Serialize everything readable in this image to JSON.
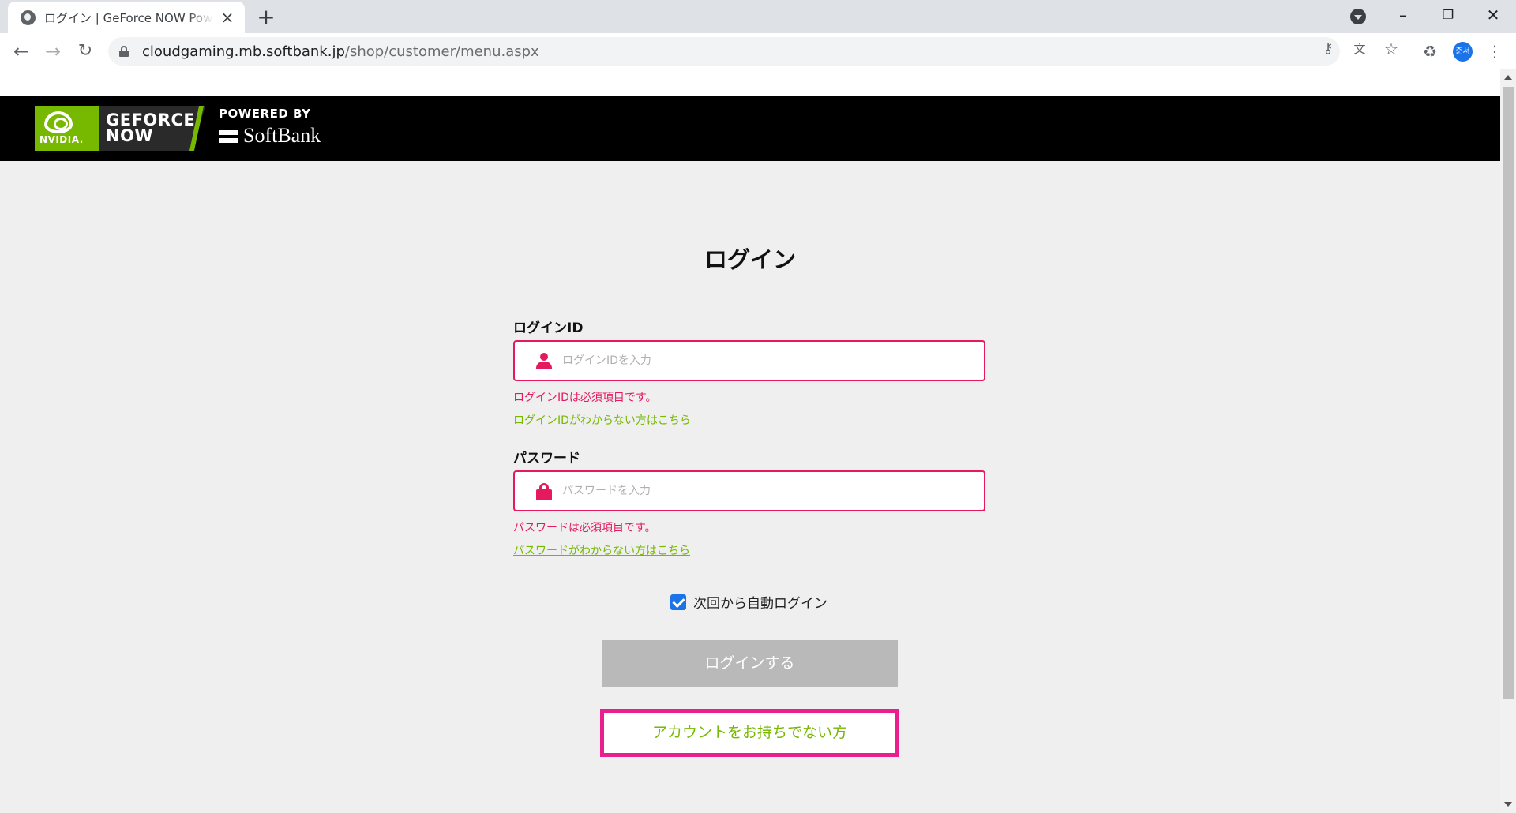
{
  "browser": {
    "tab_title": "ログイン | GeForce NOW Powered by SoftBank",
    "url_host": "cloudgaming.mb.softbank.jp",
    "url_path": "/shop/customer/menu.aspx",
    "profile_label": "준서",
    "accent_color": "#1a73e8"
  },
  "header": {
    "nvidia_label": "NVIDIA.",
    "geforce_line1": "GEFORCE",
    "geforce_line2": "NOW",
    "powered_by": "POWERED BY",
    "softbank": "SoftBank",
    "brand_green": "#76b900"
  },
  "login": {
    "title": "ログイン",
    "id_label": "ログインID",
    "id_placeholder": "ログインIDを入力",
    "id_value": "",
    "id_error": "ログインIDは必須項目です。",
    "id_help": "ログインIDがわからない方はこちら",
    "pw_label": "パスワード",
    "pw_placeholder": "パスワードを入力",
    "pw_value": "",
    "pw_error": "パスワードは必須項目です。",
    "pw_help": "パスワードがわからない方はこちら",
    "remember_label": "次回から自動ログイン",
    "remember_checked": true,
    "submit_label": "ログインする",
    "no_account_label": "アカウントをお持ちでない方",
    "error_color": "#e5195f",
    "highlight_color": "#ea1e8c"
  }
}
